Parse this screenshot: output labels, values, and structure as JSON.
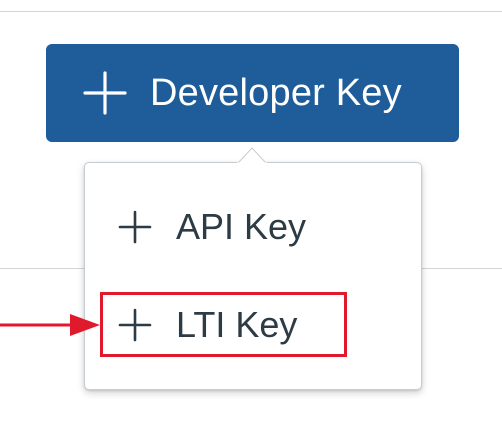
{
  "developer_keys": {
    "add_button_label": "Developer Key",
    "menu": {
      "items": [
        {
          "label": "API Key"
        },
        {
          "label": "LTI Key"
        }
      ]
    }
  },
  "colors": {
    "primary_button_bg": "#1e5c9a",
    "primary_button_text": "#ffffff",
    "menu_text": "#2d3b45",
    "annotation_red": "#e01a2c",
    "divider": "#d2d6d9"
  },
  "icons": {
    "button_icon": "plus-icon",
    "menu_item_icon": "plus-icon",
    "annotation": "arrow-right-icon"
  }
}
